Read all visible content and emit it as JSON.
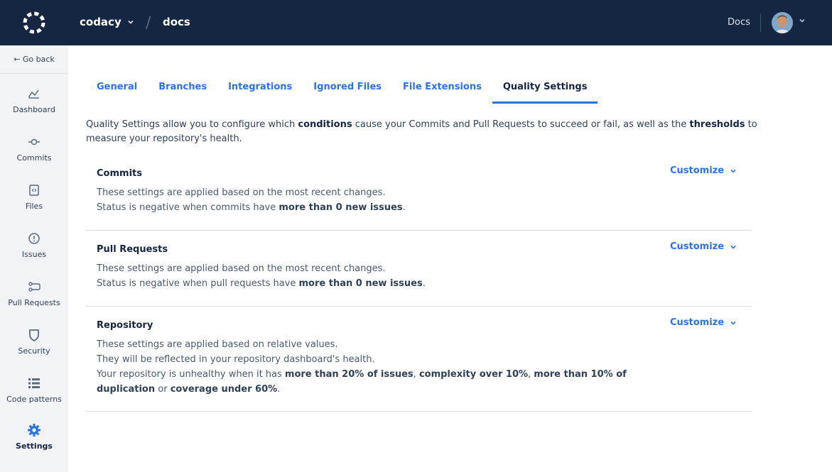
{
  "header": {
    "org": "codacy",
    "separator": "/",
    "repo": "docs",
    "docs_link": "Docs"
  },
  "sidebar": {
    "go_back": "← Go back",
    "items": [
      {
        "label": "Dashboard",
        "icon": "dashboard-icon"
      },
      {
        "label": "Commits",
        "icon": "commit-icon"
      },
      {
        "label": "Files",
        "icon": "file-icon"
      },
      {
        "label": "Issues",
        "icon": "issue-icon"
      },
      {
        "label": "Pull Requests",
        "icon": "pull-request-icon"
      },
      {
        "label": "Security",
        "icon": "shield-icon"
      },
      {
        "label": "Code patterns",
        "icon": "list-icon"
      },
      {
        "label": "Settings",
        "icon": "gear-icon"
      }
    ],
    "active": "Settings"
  },
  "tabs": [
    {
      "label": "General"
    },
    {
      "label": "Branches"
    },
    {
      "label": "Integrations"
    },
    {
      "label": "Ignored Files"
    },
    {
      "label": "File Extensions"
    },
    {
      "label": "Quality Settings"
    }
  ],
  "active_tab": "Quality Settings",
  "intro": {
    "p1": "Quality Settings allow you to configure which ",
    "b1": "conditions",
    "p2": " cause your Commits and Pull Requests to succeed or fail, as well as the ",
    "b2": "thresholds",
    "p3": " to measure your repository's health."
  },
  "sections": {
    "commits": {
      "title": "Commits",
      "line1": "These settings are applied based on the most recent changes.",
      "line2_pre": "Status is negative when commits have ",
      "line2_bold": "more than 0 new issues",
      "line2_post": ".",
      "customize": "Customize"
    },
    "pull_requests": {
      "title": "Pull Requests",
      "line1": "These settings are applied based on the most recent changes.",
      "line2_pre": "Status is negative when pull requests have ",
      "line2_bold": "more than 0 new issues",
      "line2_post": ".",
      "customize": "Customize"
    },
    "repository": {
      "title": "Repository",
      "line1": "These settings are applied based on relative values.",
      "line2": "They will be reflected in your repository dashboard's health.",
      "line3_pre": "Your repository is unhealthy when it has ",
      "b1": "more than 20% of issues",
      "sep1": ", ",
      "b2": "complexity over 10%",
      "sep2": ", ",
      "b3": "more than 10% of duplication",
      "sep3": " or ",
      "b4": "coverage under 60%",
      "end": ".",
      "customize": "Customize"
    }
  },
  "colors": {
    "topbar": "#152642",
    "accent": "#2c72e3",
    "sidebar": "#f1f3f6"
  }
}
